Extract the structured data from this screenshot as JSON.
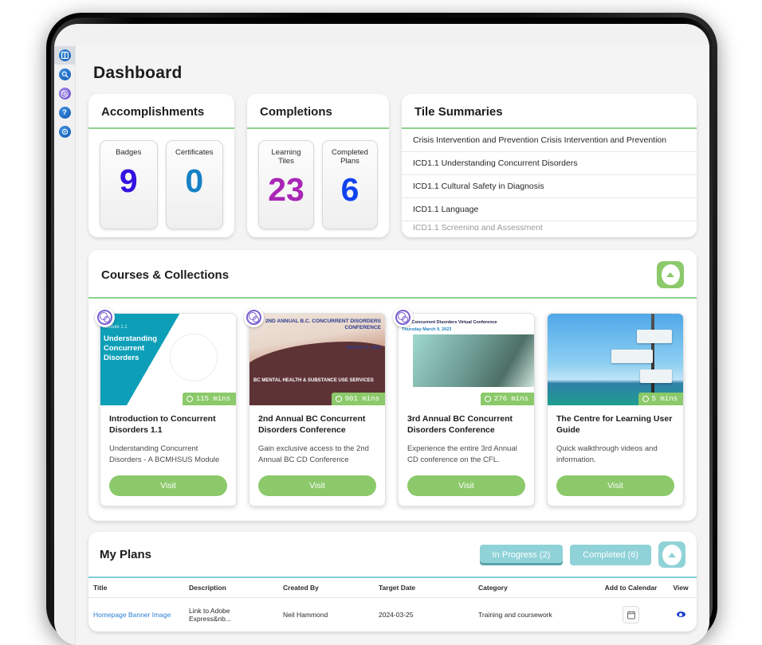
{
  "sidebar": {
    "items": [
      {
        "name": "dashboard-icon",
        "glyph": "grid",
        "color": "#0d57b0",
        "active": true
      },
      {
        "name": "search-icon",
        "glyph": "search",
        "color": "#0d57b0",
        "active": false
      },
      {
        "name": "brand-logo-icon",
        "glyph": "rings",
        "color": "#6a4fc9",
        "active": false
      },
      {
        "name": "help-icon",
        "glyph": "?",
        "color": "#0d57b0",
        "active": false
      },
      {
        "name": "chat-icon",
        "glyph": "chat",
        "color": "#0d57b0",
        "active": false
      }
    ]
  },
  "page": {
    "title": "Dashboard"
  },
  "accomplishments": {
    "heading": "Accomplishments",
    "tiles": [
      {
        "label": "Badges",
        "value": "9",
        "color": "#3412e0"
      },
      {
        "label": "Certificates",
        "value": "0",
        "color": "#1681c4"
      }
    ]
  },
  "completions": {
    "heading": "Completions",
    "tiles": [
      {
        "label": "Learning\nTiles",
        "label_line1": "Learning",
        "label_line2": "Tiles",
        "value": "23",
        "color": "#a926b6"
      },
      {
        "label": "Completed\nPlans",
        "label_line1": "Completed",
        "label_line2": "Plans",
        "value": "6",
        "color": "#1144ef"
      }
    ]
  },
  "tile_summaries": {
    "heading": "Tile Summaries",
    "rows": [
      "Crisis Intervention and Prevention Crisis Intervention and Prevention",
      "ICD1.1 Understanding Concurrent Disorders",
      "ICD1.1 Cultural Safety in Diagnosis",
      "ICD1.1 Language"
    ]
  },
  "courses": {
    "heading": "Courses & Collections",
    "collapse_icon": "chevron-up-icon",
    "cards": [
      {
        "title": "Introduction to Concurrent Disorders 1.1",
        "description": "Understanding Concurrent Disorders - A BCMHSUS Module",
        "duration": "115 mins",
        "button": "Visit",
        "thumb_sup": "Module 1.1",
        "thumb_title": "Understanding Concurrent Disorders"
      },
      {
        "title": "2nd Annual BC Concurrent Disorders Conference",
        "description": "Gain exclusive access to the 2nd Annual BC CD Conference",
        "duration": "901 mins",
        "button": "Visit",
        "thumb_cap": "2ND ANNUAL B.C. CONCURRENT DISORDERS CONFERENCE",
        "thumb_cap2": "MARCH 31, 2022",
        "thumb_org": "BC MENTAL HEALTH & SUBSTANCE USE SERVICES"
      },
      {
        "title": "3rd Annual BC Concurrent Disorders Conference",
        "description": "Experience the entire 3rd Annual CD conference on the CFL.",
        "duration": "276 mins",
        "button": "Visit",
        "thumb_h1": "B.C. Concurrent Disorders Virtual Conference",
        "thumb_h2": "Thursday March 9, 2023"
      },
      {
        "title": "The Centre for Learning User Guide",
        "description": "Quick walkthrough videos and information.",
        "duration": "5 mins",
        "button": "Visit"
      }
    ]
  },
  "my_plans": {
    "heading": "My Plans",
    "in_progress_label": "In Progress (2)",
    "completed_label": "Completed (6)",
    "collapse_icon": "chevron-up-icon",
    "columns": [
      "Title",
      "Description",
      "Created By",
      "Target Date",
      "Category",
      "Add to Calendar",
      "View"
    ],
    "rows": [
      {
        "title": "Homepage Banner Image",
        "description": "Link to Adobe Express&nb...",
        "created_by": "Neil Hammond",
        "target_date": "2024-03-25",
        "category": "Training and coursework",
        "calendar_icon": "calendar-icon",
        "view_icon": "eye-icon"
      }
    ]
  },
  "colors": {
    "accent_green": "#8bc96a",
    "accent_teal": "#8fd2d8",
    "link_blue": "#2b7fd0"
  }
}
